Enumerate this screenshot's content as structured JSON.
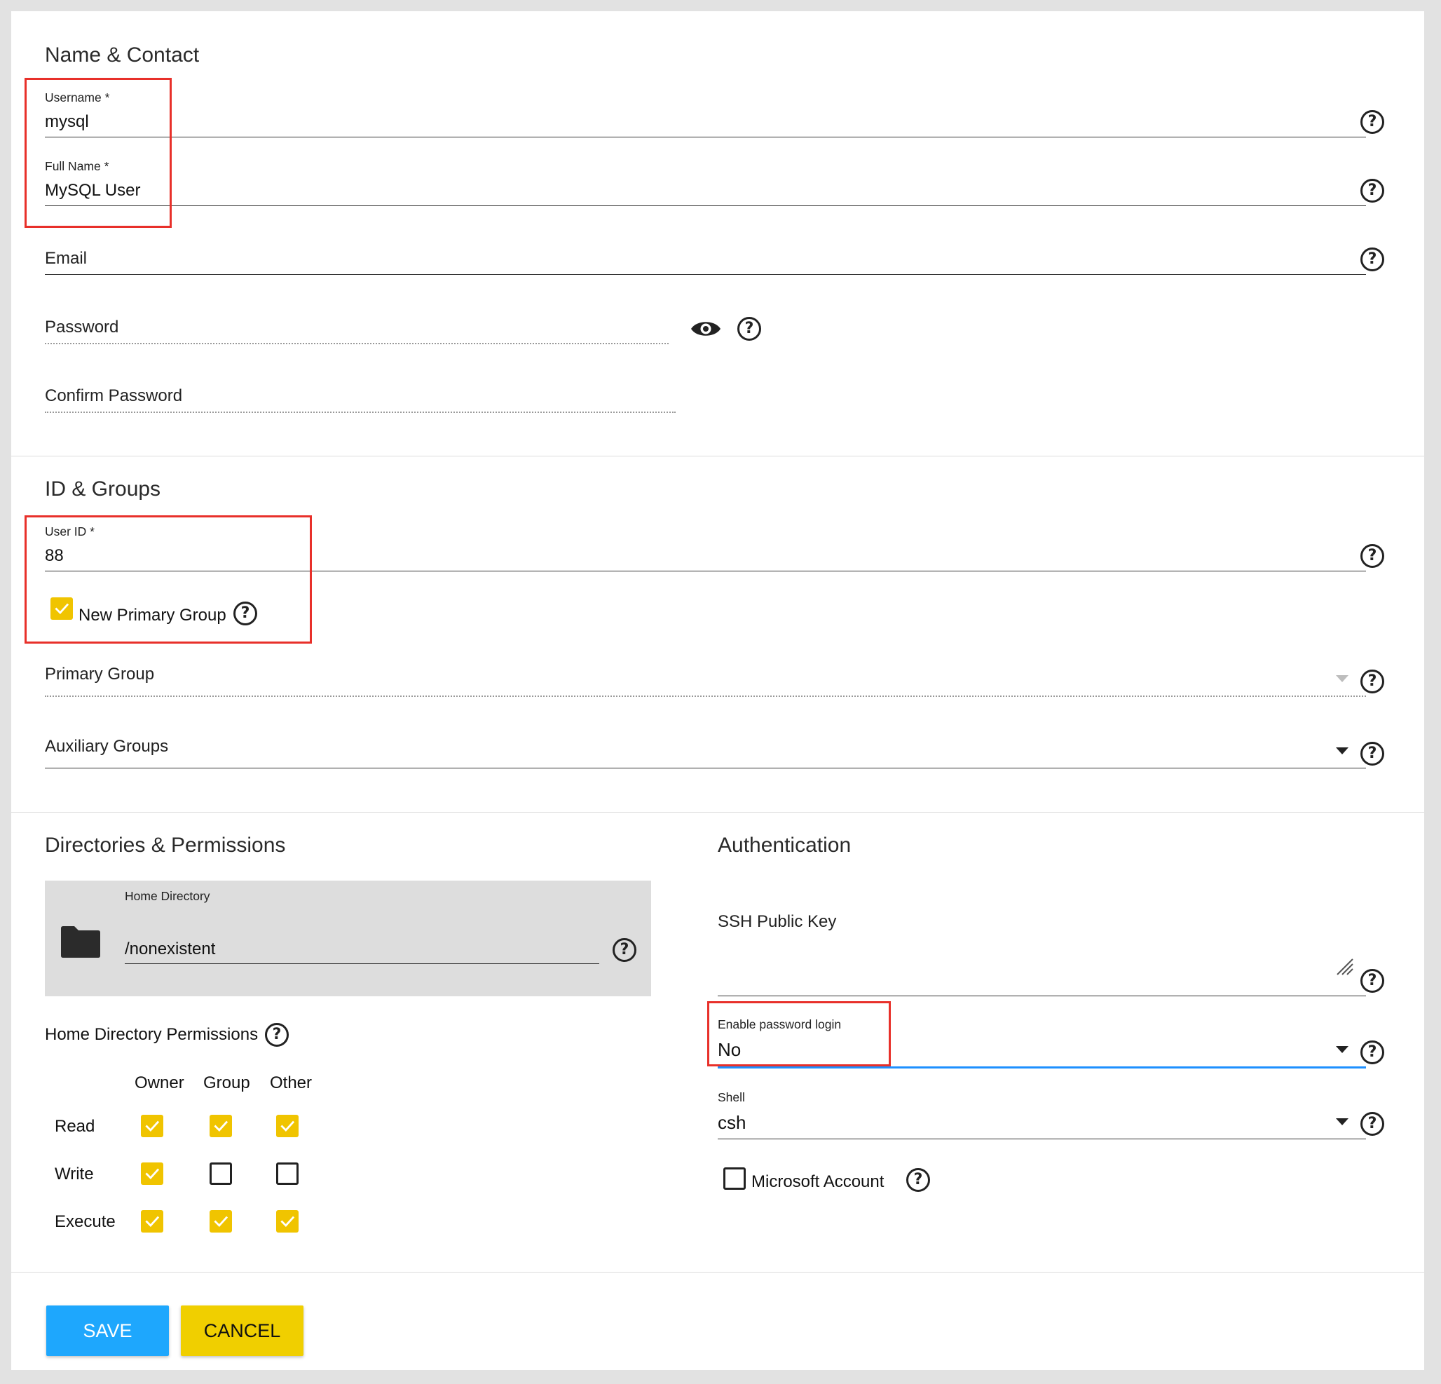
{
  "colors": {
    "save_bg": "#1ea7fd",
    "cancel_bg": "#f0cf00",
    "checkbox_on": "#f0c400",
    "focus_line": "#1e90ff",
    "highlight_box": "#e8302a"
  },
  "name_contact": {
    "title": "Name & Contact",
    "username": {
      "label": "Username *",
      "value": "mysql"
    },
    "full_name": {
      "label": "Full Name *",
      "value": "MySQL User"
    },
    "email": {
      "label": "Email"
    },
    "password": {
      "label": "Password"
    },
    "confirm_password": {
      "label": "Confirm Password"
    }
  },
  "id_groups": {
    "title": "ID & Groups",
    "user_id": {
      "label": "User ID *",
      "value": "88"
    },
    "new_primary_group": {
      "label": "New Primary Group",
      "checked": true
    },
    "primary_group": {
      "label": "Primary Group"
    },
    "auxiliary_groups": {
      "label": "Auxiliary Groups"
    }
  },
  "directories": {
    "title": "Directories & Permissions",
    "home_directory": {
      "label": "Home Directory",
      "value": "/nonexistent"
    },
    "permissions_label": "Home Directory Permissions",
    "columns": [
      "Owner",
      "Group",
      "Other"
    ],
    "rows": [
      {
        "label": "Read",
        "values": [
          true,
          true,
          true
        ]
      },
      {
        "label": "Write",
        "values": [
          true,
          false,
          false
        ]
      },
      {
        "label": "Execute",
        "values": [
          true,
          true,
          true
        ]
      }
    ]
  },
  "authentication": {
    "title": "Authentication",
    "ssh_key": {
      "label": "SSH Public Key"
    },
    "password_login": {
      "label": "Enable password login",
      "value": "No"
    },
    "shell": {
      "label": "Shell",
      "value": "csh"
    },
    "microsoft_account": {
      "label": "Microsoft Account",
      "checked": false
    }
  },
  "actions": {
    "save": "SAVE",
    "cancel": "CANCEL"
  }
}
